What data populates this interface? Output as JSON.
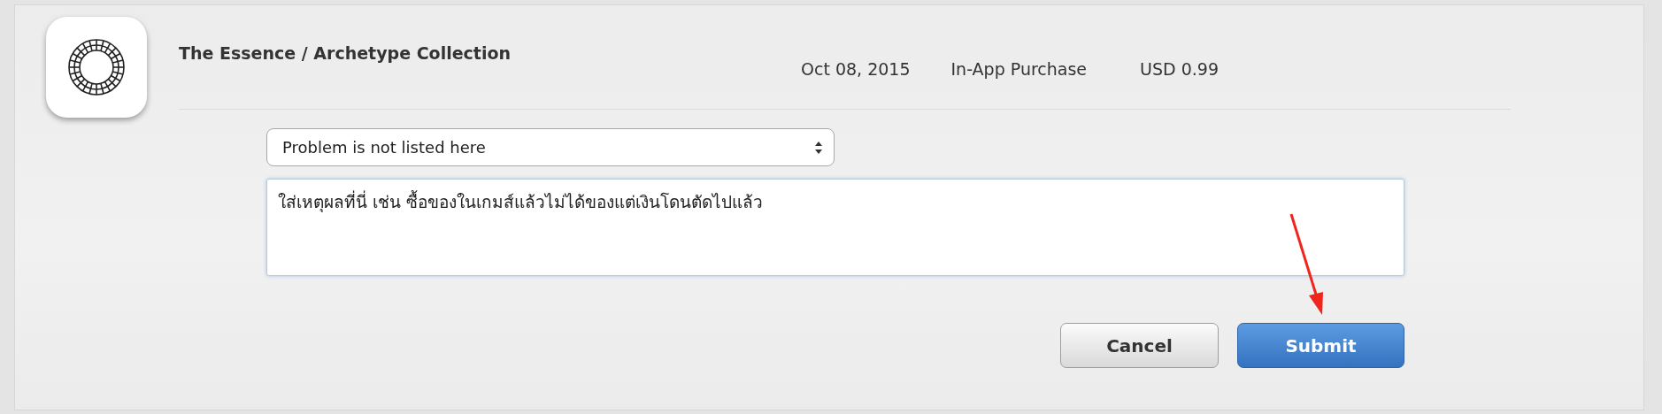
{
  "item": {
    "title": "The Essence / Archetype Collection",
    "date": "Oct 08, 2015",
    "type": "In-App Purchase",
    "price": "USD 0.99"
  },
  "problem_select": {
    "value": "Problem is not listed here"
  },
  "reason_field": {
    "value": "ใส่เหตุผลที่นี่ เช่น ซื้อของในเกมส์แล้วไม่ได้ของแต่เงินโดนตัดไปแล้ว"
  },
  "buttons": [
    {
      "label": "Cancel",
      "kind": "secondary"
    },
    {
      "label": "Submit",
      "kind": "primary"
    }
  ]
}
